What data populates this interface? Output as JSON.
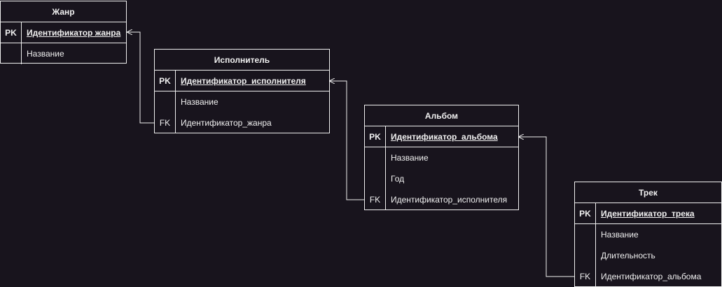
{
  "entities": {
    "genre": {
      "title": "Жанр",
      "pk_label": "PK",
      "pk_field": "Идентификатор жанра",
      "fields": [
        {
          "key": "",
          "name": "Название"
        }
      ]
    },
    "artist": {
      "title": "Исполнитель",
      "pk_label": "PK",
      "pk_field": "Идентификатор_исполнителя",
      "fields": [
        {
          "key": "",
          "name": "Название"
        },
        {
          "key": "FK",
          "name": "Идентификатор_жанра"
        }
      ]
    },
    "album": {
      "title": "Альбом",
      "pk_label": "PK",
      "pk_field": "Идентификатор_альбома",
      "fields": [
        {
          "key": "",
          "name": "Название"
        },
        {
          "key": "",
          "name": "Год"
        },
        {
          "key": "FK",
          "name": "Идентификатор_исполнителя"
        }
      ]
    },
    "track": {
      "title": "Трек",
      "pk_label": "PK",
      "pk_field": "Идентификатор_трека",
      "fields": [
        {
          "key": "",
          "name": "Название"
        },
        {
          "key": "",
          "name": "Длительность"
        },
        {
          "key": "FK",
          "name": "Идентификатор_альбома"
        }
      ]
    }
  },
  "colors": {
    "background": "#18141d",
    "stroke": "#f0f0f0"
  }
}
